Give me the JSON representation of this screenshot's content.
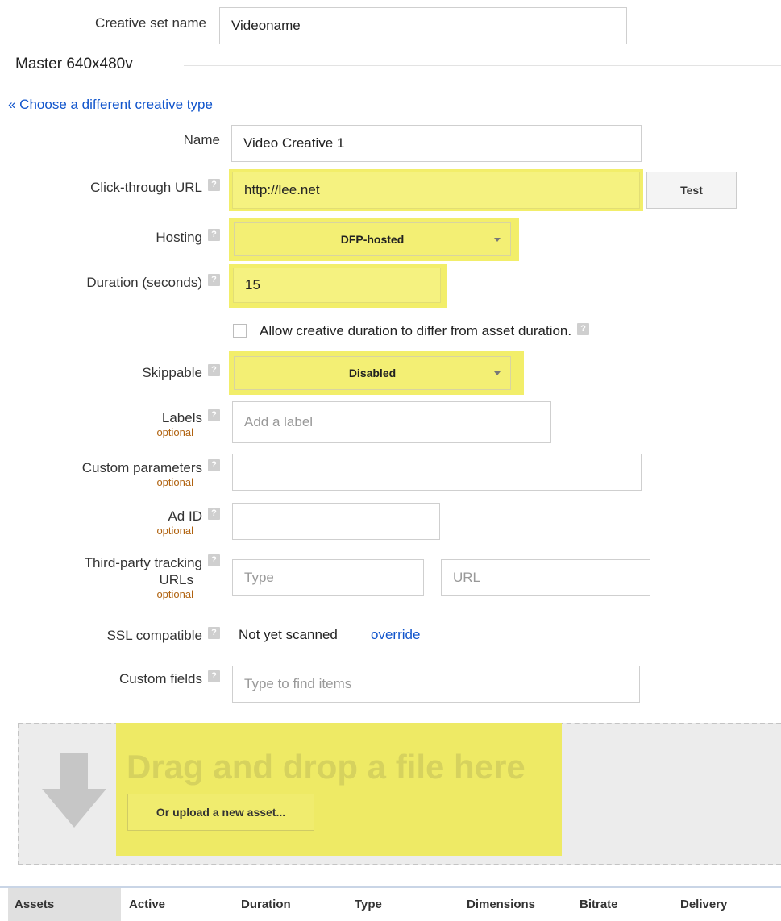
{
  "creative_set": {
    "label": "Creative set name",
    "value": "Videoname"
  },
  "section_title": "Master 640x480v",
  "choose_link": "« Choose a different creative type",
  "form": {
    "name": {
      "label": "Name",
      "value": "Video Creative 1"
    },
    "click_through": {
      "label": "Click-through URL",
      "value": "http://lee.net",
      "test_button": "Test"
    },
    "hosting": {
      "label": "Hosting",
      "selected": "DFP-hosted"
    },
    "duration": {
      "label": "Duration (seconds)",
      "value": "15"
    },
    "allow_differ": {
      "label": "Allow creative duration to differ from asset duration.",
      "checked": false
    },
    "skippable": {
      "label": "Skippable",
      "selected": "Disabled"
    },
    "labels": {
      "label": "Labels",
      "optional": "optional",
      "placeholder": "Add a label"
    },
    "custom_params": {
      "label": "Custom parameters",
      "optional": "optional",
      "value": ""
    },
    "ad_id": {
      "label": "Ad ID",
      "optional": "optional",
      "value": ""
    },
    "third_party": {
      "label_line1": "Third-party tracking",
      "label_line2": "URLs",
      "optional": "optional",
      "type_placeholder": "Type",
      "url_placeholder": "URL"
    },
    "ssl": {
      "label": "SSL compatible",
      "status": "Not yet scanned",
      "override": "override"
    },
    "custom_fields": {
      "label": "Custom fields",
      "placeholder": "Type to find items"
    }
  },
  "help_icon_glyph": "?",
  "dropzone": {
    "title": "Drag and drop a file here",
    "upload_button": "Or upload a new asset..."
  },
  "assets_table": {
    "headers": [
      "Assets",
      "Active",
      "Duration",
      "Type",
      "Dimensions",
      "Bitrate",
      "Delivery"
    ]
  },
  "colors": {
    "highlight": "#f2ee6a",
    "link": "#1155cc",
    "optional": "#b0620f"
  }
}
